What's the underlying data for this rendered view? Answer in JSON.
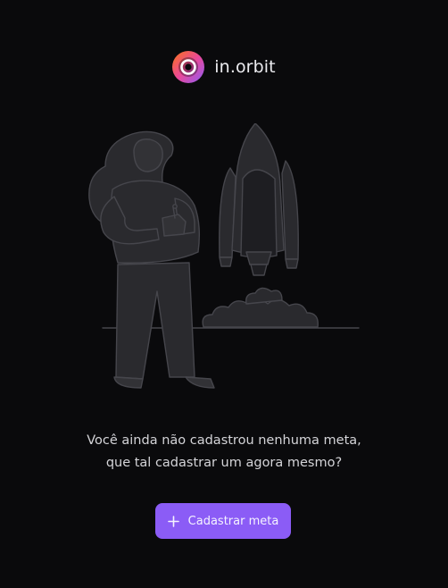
{
  "brand": {
    "name": "in.orbit",
    "gradient_start": "#f97316",
    "gradient_mid": "#ec4899",
    "gradient_end": "#8b5cf6"
  },
  "illustration": {
    "icon": "woman-launching-rocket-illustration"
  },
  "empty_state": {
    "line1": "Você ainda não cadastrou nenhuma meta,",
    "line2": "que tal cadastrar um agora mesmo?"
  },
  "cta": {
    "label": "Cadastrar meta",
    "icon": "plus-icon",
    "color": "#8b5cf6"
  },
  "colors": {
    "background": "#0a0a0c",
    "illustration_fill": "#2a2a2e",
    "illustration_stroke": "#46464c"
  }
}
